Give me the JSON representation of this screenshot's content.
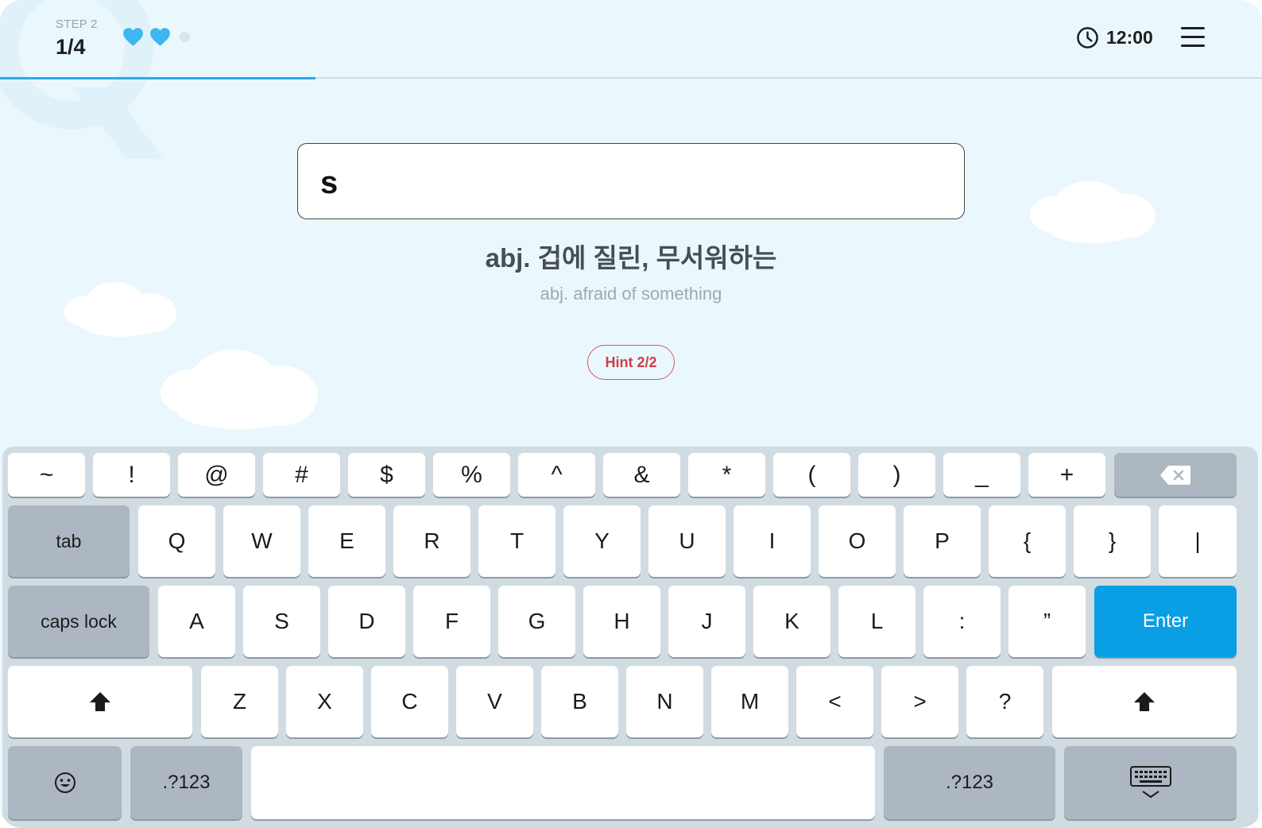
{
  "header": {
    "step_label": "STEP 2",
    "progress": "1/4",
    "lives_total": 3,
    "lives_remaining": 2,
    "timer": "12:00",
    "progress_fraction": 0.25
  },
  "quiz": {
    "answer_input": "s",
    "meaning_ko": "abj. 겁에 질린, 무서워하는",
    "meaning_en": "abj. afraid of something",
    "hint_label": "Hint 2/2"
  },
  "keyboard": {
    "row0": [
      "~",
      "!",
      "@",
      "#",
      "$",
      "%",
      "^",
      "&",
      "*",
      "(",
      ")",
      "_",
      "+"
    ],
    "row1": [
      "tab",
      "Q",
      "W",
      "E",
      "R",
      "T",
      "Y",
      "U",
      "I",
      "O",
      "P",
      "{",
      "}",
      "|"
    ],
    "row2": [
      "caps lock",
      "A",
      "S",
      "D",
      "F",
      "G",
      "H",
      "J",
      "K",
      "L",
      ":",
      "”",
      "Enter"
    ],
    "row3": [
      "Z",
      "X",
      "C",
      "V",
      "B",
      "N",
      "M",
      "<",
      ">",
      "?"
    ],
    "row4": [
      ".?123",
      ".?123"
    ]
  },
  "colors": {
    "background": "#eaf8fd",
    "accent": "#2aa9e6",
    "heart": "#3db6f2",
    "hint": "#d13c48",
    "enter_key": "#0a9ee4"
  },
  "icons": {
    "backspace": "backspace-icon",
    "shift": "shift-icon",
    "emoji": "emoji-icon",
    "hide_keyboard": "hide-keyboard-icon",
    "clock": "clock-icon",
    "menu": "hamburger-menu-icon",
    "heart": "heart-icon"
  }
}
